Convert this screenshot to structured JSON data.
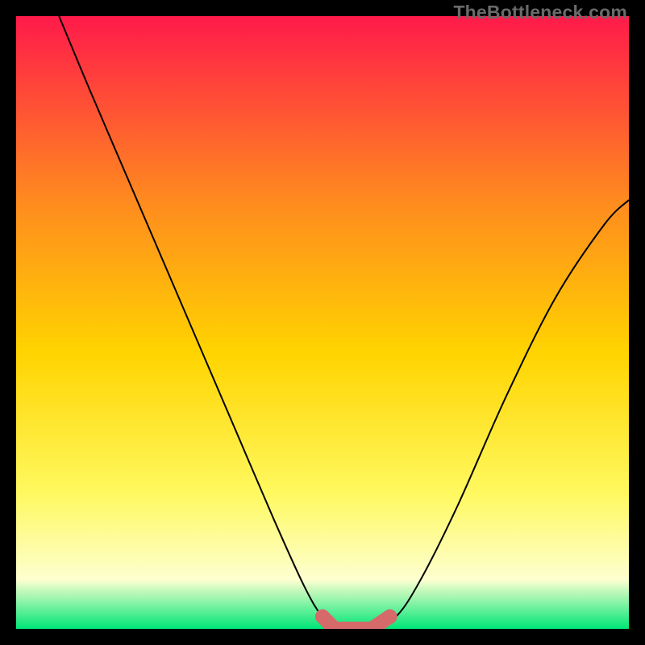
{
  "watermark": "TheBottleneck.com",
  "colors": {
    "frame": "#000000",
    "gradient_top": "#ff1a4a",
    "gradient_mid1": "#ff8a1f",
    "gradient_mid2": "#ffd400",
    "gradient_mid3": "#fff960",
    "gradient_mid4": "#fdffd0",
    "gradient_bottom": "#00e676",
    "curve": "#000000",
    "marker": "#d66a6a"
  },
  "chart_data": {
    "type": "line",
    "title": "",
    "xlabel": "",
    "ylabel": "",
    "xlim": [
      0,
      100
    ],
    "ylim": [
      0,
      100
    ],
    "grid": false,
    "legend": false,
    "annotations": [],
    "series": [
      {
        "name": "bottleneck-curve",
        "points": [
          {
            "x": 7,
            "y": 100
          },
          {
            "x": 12,
            "y": 88
          },
          {
            "x": 18,
            "y": 74
          },
          {
            "x": 24,
            "y": 60
          },
          {
            "x": 30,
            "y": 46
          },
          {
            "x": 36,
            "y": 32
          },
          {
            "x": 42,
            "y": 18
          },
          {
            "x": 47,
            "y": 7
          },
          {
            "x": 50,
            "y": 2
          },
          {
            "x": 53,
            "y": 0
          },
          {
            "x": 58,
            "y": 0
          },
          {
            "x": 62,
            "y": 2
          },
          {
            "x": 66,
            "y": 8
          },
          {
            "x": 72,
            "y": 20
          },
          {
            "x": 80,
            "y": 38
          },
          {
            "x": 88,
            "y": 54
          },
          {
            "x": 96,
            "y": 66
          },
          {
            "x": 100,
            "y": 70
          }
        ]
      }
    ],
    "markers": [
      {
        "name": "optimal-range-left-cap",
        "x": 50,
        "y": 2
      },
      {
        "name": "optimal-range-floor-1",
        "x": 52,
        "y": 0
      },
      {
        "name": "optimal-range-floor-2",
        "x": 55,
        "y": 0
      },
      {
        "name": "optimal-range-floor-3",
        "x": 58,
        "y": 0
      },
      {
        "name": "optimal-range-right-cap",
        "x": 61,
        "y": 2
      }
    ]
  }
}
